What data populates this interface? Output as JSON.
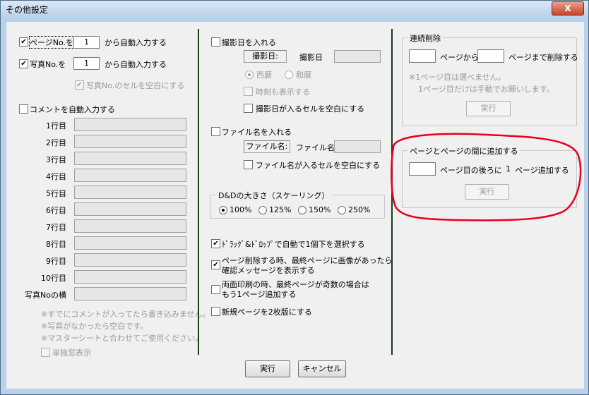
{
  "window": {
    "title": "その他設定",
    "close_glyph": "X"
  },
  "left": {
    "page_no_label": "ページNo.を",
    "page_no_value": "1",
    "page_no_suffix": "から自動入力する",
    "photo_no_label": "写真No.を",
    "photo_no_value": "1",
    "photo_no_suffix": "から自動入力する",
    "photo_blank_label": "写真No.のセルを空白にする",
    "comment_label": "コメントを自動入力する",
    "rows": [
      "1行目",
      "2行目",
      "3行目",
      "4行目",
      "5行目",
      "6行目",
      "7行目",
      "8行目",
      "9行目",
      "10行目",
      "写真Noの横"
    ],
    "notes": [
      "※すでにコメントが入ってたら書き込みません。",
      "※写真がなかったら空白です。",
      "※マスターシートと合わせてご使用ください。"
    ],
    "single_window_label": "単独窓表示"
  },
  "middle": {
    "shoot_date_label": "撮影日を入れる",
    "shoot_date_tag": "撮影日:",
    "shoot_date_text": "撮影日",
    "era_western": "西暦",
    "era_japanese": "和暦",
    "show_time_label": "時刻も表示する",
    "shoot_blank_label": "撮影日が入るセルを空白にする",
    "filename_label": "ファイル名を入れる",
    "filename_tag": "ファイル名:",
    "filename_text": "ファイル名",
    "filename_blank_label": "ファイル名が入るセルを空白にする",
    "scale_group": "D&Dの大きさ（スケーリング）",
    "scale_options": [
      "100%",
      "125%",
      "150%",
      "250%"
    ],
    "dragdrop_label": "ﾄﾞﾗｯｸﾞ&ﾄﾞﾛｯﾌﾟで自動で1個下を選択する",
    "confirm_line1": "ページ削除する時、最終ページに画像があったら",
    "confirm_line2": "確認メッセージを表示する",
    "duplex_line1": "両面印刷の時、最終ページが奇数の場合は",
    "duplex_line2": "もう1ページ追加する",
    "new_page_label": "新規ページを2枚版にする"
  },
  "right": {
    "delete_group": "連続削除",
    "from_label": "ページから",
    "to_label": "ページまで削除する",
    "note1": "※1ページ目は選べません。",
    "note2": "1ページ目だけは手動でお願いします。",
    "run": "実行",
    "add_group": "ページとページの間に追加する",
    "after_label": "ページ目の後ろに",
    "count": "1",
    "add_suffix": "ページ追加する"
  },
  "footer": {
    "ok": "実行",
    "cancel": "キャンセル"
  },
  "colors": {
    "annotation": "#e8001c",
    "separator": "#1c3a1c"
  }
}
